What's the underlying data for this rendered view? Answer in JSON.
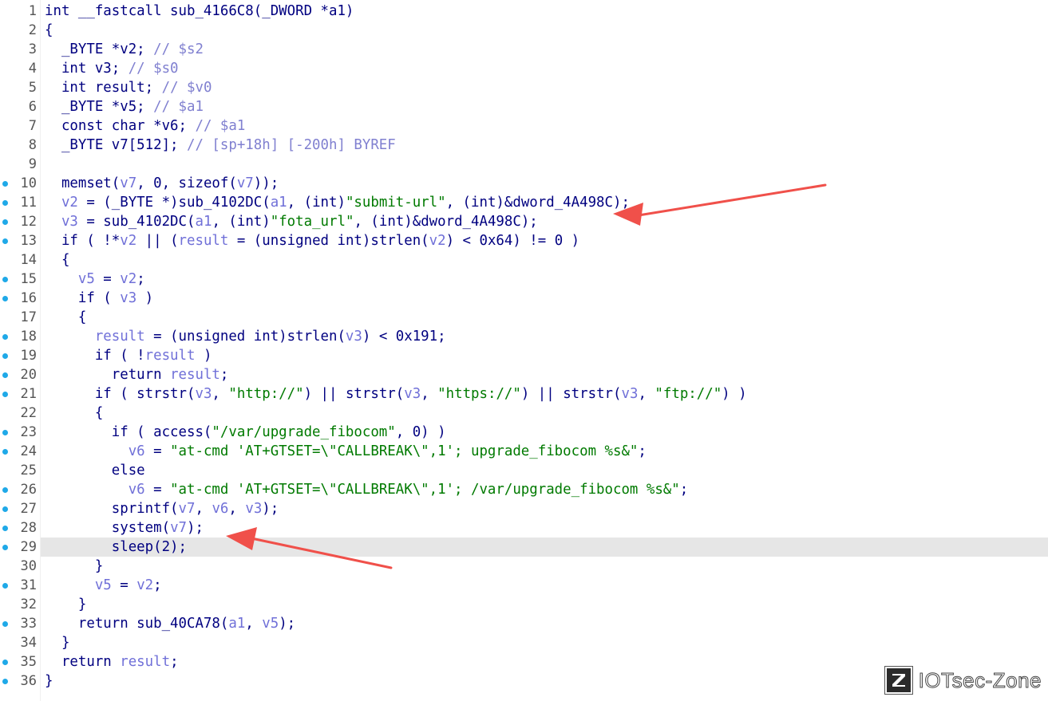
{
  "editor": {
    "breakpoint_color": "#1fa9e8",
    "highlight_line": 29,
    "lines": [
      {
        "n": "1",
        "dot": false,
        "tokens": [
          [
            "k",
            "int __fastcall sub_4166C8(_DWORD *a1)"
          ]
        ]
      },
      {
        "n": "2",
        "dot": false,
        "tokens": [
          [
            "k",
            "{"
          ]
        ]
      },
      {
        "n": "3",
        "dot": false,
        "tokens": [
          [
            "k",
            "  _BYTE *v2; "
          ],
          [
            "c",
            "// $s2"
          ]
        ]
      },
      {
        "n": "4",
        "dot": false,
        "tokens": [
          [
            "k",
            "  int v3; "
          ],
          [
            "c",
            "// $s0"
          ]
        ]
      },
      {
        "n": "5",
        "dot": false,
        "tokens": [
          [
            "k",
            "  int result; "
          ],
          [
            "c",
            "// $v0"
          ]
        ]
      },
      {
        "n": "6",
        "dot": false,
        "tokens": [
          [
            "k",
            "  _BYTE *v5; "
          ],
          [
            "c",
            "// $a1"
          ]
        ]
      },
      {
        "n": "7",
        "dot": false,
        "tokens": [
          [
            "k",
            "  const char *v6; "
          ],
          [
            "c",
            "// $a1"
          ]
        ]
      },
      {
        "n": "8",
        "dot": false,
        "tokens": [
          [
            "k",
            "  _BYTE v7[512]; "
          ],
          [
            "c",
            "// [sp+18h] [-200h] BYREF"
          ]
        ]
      },
      {
        "n": "9",
        "dot": false,
        "tokens": [
          [
            "k",
            ""
          ]
        ]
      },
      {
        "n": "10",
        "dot": true,
        "tokens": [
          [
            "k",
            "  memset("
          ],
          [
            "v",
            "v7"
          ],
          [
            "k",
            ", 0, sizeof("
          ],
          [
            "v",
            "v7"
          ],
          [
            "k",
            "));"
          ]
        ]
      },
      {
        "n": "11",
        "dot": true,
        "tokens": [
          [
            "v",
            "  v2"
          ],
          [
            "k",
            " = (_BYTE *)sub_4102DC("
          ],
          [
            "v",
            "a1"
          ],
          [
            "k",
            ", (int)"
          ],
          [
            "s",
            "\"submit-url\""
          ],
          [
            "k",
            ", (int)&dword_4A498C);"
          ]
        ]
      },
      {
        "n": "12",
        "dot": true,
        "tokens": [
          [
            "v",
            "  v3"
          ],
          [
            "k",
            " = sub_4102DC("
          ],
          [
            "v",
            "a1"
          ],
          [
            "k",
            ", (int)"
          ],
          [
            "s",
            "\"fota_url\""
          ],
          [
            "k",
            ", (int)&dword_4A498C);"
          ]
        ]
      },
      {
        "n": "13",
        "dot": true,
        "tokens": [
          [
            "k",
            "  if ( !*"
          ],
          [
            "v",
            "v2"
          ],
          [
            "k",
            " || ("
          ],
          [
            "v",
            "result"
          ],
          [
            "k",
            " = (unsigned int)strlen("
          ],
          [
            "v",
            "v2"
          ],
          [
            "k",
            ") < 0x64) != 0 )"
          ]
        ]
      },
      {
        "n": "14",
        "dot": false,
        "tokens": [
          [
            "k",
            "  {"
          ]
        ]
      },
      {
        "n": "15",
        "dot": true,
        "tokens": [
          [
            "v",
            "    v5"
          ],
          [
            "k",
            " = "
          ],
          [
            "v",
            "v2"
          ],
          [
            "k",
            ";"
          ]
        ]
      },
      {
        "n": "16",
        "dot": true,
        "tokens": [
          [
            "k",
            "    if ( "
          ],
          [
            "v",
            "v3"
          ],
          [
            "k",
            " )"
          ]
        ]
      },
      {
        "n": "17",
        "dot": false,
        "tokens": [
          [
            "k",
            "    {"
          ]
        ]
      },
      {
        "n": "18",
        "dot": true,
        "tokens": [
          [
            "v",
            "      result"
          ],
          [
            "k",
            " = (unsigned int)strlen("
          ],
          [
            "v",
            "v3"
          ],
          [
            "k",
            ") < 0x191;"
          ]
        ]
      },
      {
        "n": "19",
        "dot": true,
        "tokens": [
          [
            "k",
            "      if ( !"
          ],
          [
            "v",
            "result"
          ],
          [
            "k",
            " )"
          ]
        ]
      },
      {
        "n": "20",
        "dot": true,
        "tokens": [
          [
            "k",
            "        return "
          ],
          [
            "v",
            "result"
          ],
          [
            "k",
            ";"
          ]
        ]
      },
      {
        "n": "21",
        "dot": true,
        "tokens": [
          [
            "k",
            "      if ( strstr("
          ],
          [
            "v",
            "v3"
          ],
          [
            "k",
            ", "
          ],
          [
            "s",
            "\"http://\""
          ],
          [
            "k",
            ") || strstr("
          ],
          [
            "v",
            "v3"
          ],
          [
            "k",
            ", "
          ],
          [
            "s",
            "\"https://\""
          ],
          [
            "k",
            ") || strstr("
          ],
          [
            "v",
            "v3"
          ],
          [
            "k",
            ", "
          ],
          [
            "s",
            "\"ftp://\""
          ],
          [
            "k",
            ") )"
          ]
        ]
      },
      {
        "n": "22",
        "dot": false,
        "tokens": [
          [
            "k",
            "      {"
          ]
        ]
      },
      {
        "n": "23",
        "dot": true,
        "tokens": [
          [
            "k",
            "        if ( access("
          ],
          [
            "s",
            "\"/var/upgrade_fibocom\""
          ],
          [
            "k",
            ", 0) )"
          ]
        ]
      },
      {
        "n": "24",
        "dot": true,
        "tokens": [
          [
            "v",
            "          v6"
          ],
          [
            "k",
            " = "
          ],
          [
            "s",
            "\"at-cmd 'AT+GTSET=\\\"CALLBREAK\\\",1'; upgrade_fibocom %s&\""
          ],
          [
            "k",
            ";"
          ]
        ]
      },
      {
        "n": "25",
        "dot": false,
        "tokens": [
          [
            "k",
            "        else"
          ]
        ]
      },
      {
        "n": "26",
        "dot": true,
        "tokens": [
          [
            "v",
            "          v6"
          ],
          [
            "k",
            " = "
          ],
          [
            "s",
            "\"at-cmd 'AT+GTSET=\\\"CALLBREAK\\\",1'; /var/upgrade_fibocom %s&\""
          ],
          [
            "k",
            ";"
          ]
        ]
      },
      {
        "n": "27",
        "dot": true,
        "tokens": [
          [
            "k",
            "        sprintf("
          ],
          [
            "v",
            "v7"
          ],
          [
            "k",
            ", "
          ],
          [
            "v",
            "v6"
          ],
          [
            "k",
            ", "
          ],
          [
            "v",
            "v3"
          ],
          [
            "k",
            ");"
          ]
        ]
      },
      {
        "n": "28",
        "dot": true,
        "tokens": [
          [
            "k",
            "        system("
          ],
          [
            "v",
            "v7"
          ],
          [
            "k",
            ");"
          ]
        ]
      },
      {
        "n": "29",
        "dot": true,
        "tokens": [
          [
            "k",
            "        sleep(2);"
          ]
        ]
      },
      {
        "n": "30",
        "dot": false,
        "tokens": [
          [
            "k",
            "      }"
          ]
        ]
      },
      {
        "n": "31",
        "dot": true,
        "tokens": [
          [
            "v",
            "      v5"
          ],
          [
            "k",
            " = "
          ],
          [
            "v",
            "v2"
          ],
          [
            "k",
            ";"
          ]
        ]
      },
      {
        "n": "32",
        "dot": false,
        "tokens": [
          [
            "k",
            "    }"
          ]
        ]
      },
      {
        "n": "33",
        "dot": true,
        "tokens": [
          [
            "k",
            "    return sub_40CA78("
          ],
          [
            "v",
            "a1"
          ],
          [
            "k",
            ", "
          ],
          [
            "v",
            "v5"
          ],
          [
            "k",
            ");"
          ]
        ]
      },
      {
        "n": "34",
        "dot": false,
        "tokens": [
          [
            "k",
            "  }"
          ]
        ]
      },
      {
        "n": "35",
        "dot": true,
        "tokens": [
          [
            "k",
            "  return "
          ],
          [
            "v",
            "result"
          ],
          [
            "k",
            ";"
          ]
        ]
      },
      {
        "n": "36",
        "dot": true,
        "tokens": [
          [
            "k",
            "}"
          ]
        ]
      }
    ]
  },
  "annotations": {
    "arrow_color": "#f0504a"
  },
  "watermark": {
    "logo_letter": "Z",
    "text": "IOTsec-Zone"
  }
}
